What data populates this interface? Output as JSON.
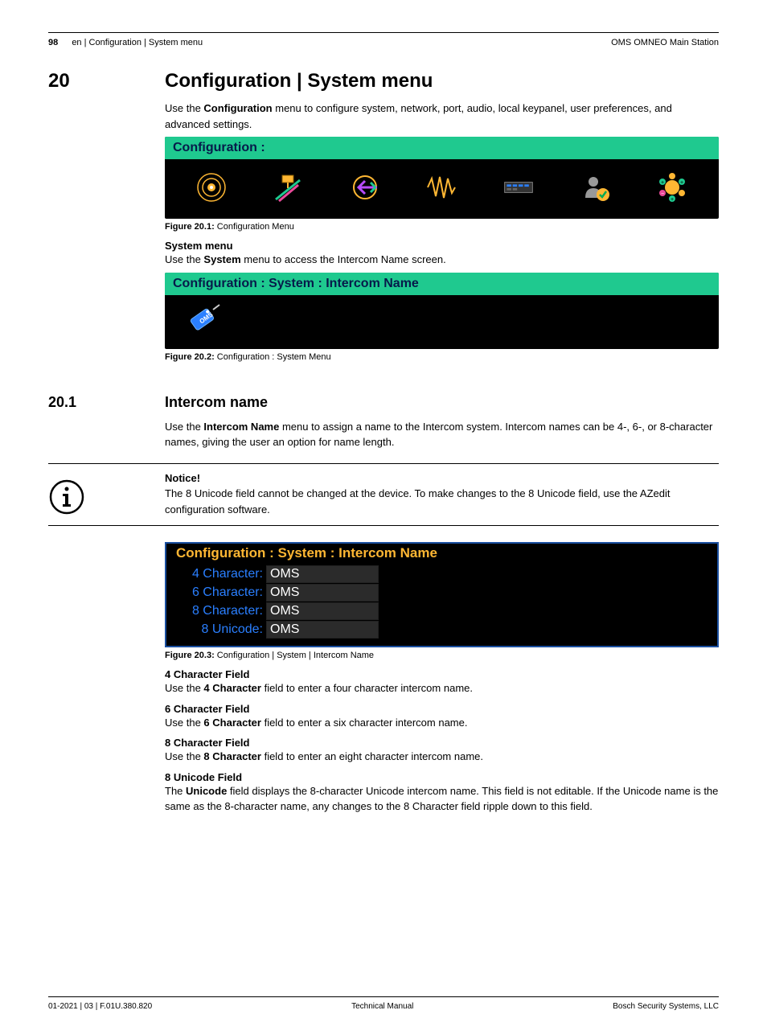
{
  "header": {
    "page_number": "98",
    "breadcrumb": "en | Configuration | System menu",
    "product": "OMS OMNEO Main Station"
  },
  "section": {
    "number": "20",
    "title": "Configuration | System menu",
    "intro_pre": "Use the ",
    "intro_bold": "Configuration",
    "intro_post": " menu to configure system, network, port, audio, local keypanel, user preferences, and advanced settings."
  },
  "fig1": {
    "header": "Configuration :",
    "caption_label": "Figure 20.1:",
    "caption_text": " Configuration Menu"
  },
  "sysmenu": {
    "heading": "System menu",
    "pre": "Use the ",
    "bold": "System",
    "post": " menu to access the Intercom Name screen."
  },
  "fig2": {
    "header": "Configuration : System : Intercom Name",
    "caption_label": "Figure 20.2:",
    "caption_text": " Configuration : System Menu"
  },
  "sub": {
    "number": "20.1",
    "title": "Intercom name",
    "p_pre": "Use the ",
    "p_bold": "Intercom Name",
    "p_post": " menu to assign a name to the Intercom system. Intercom names can be 4-, 6-, or 8-character names, giving the user an option for name length."
  },
  "notice": {
    "heading": "Notice!",
    "body": "The 8 Unicode field cannot be changed at the device. To make changes to the 8 Unicode field, use the AZedit configuration software."
  },
  "fig3": {
    "header": "Configuration : System : Intercom Name",
    "rows": [
      {
        "label": "4 Character:",
        "value": "OMS"
      },
      {
        "label": "6 Character:",
        "value": "OMS"
      },
      {
        "label": "8 Character:",
        "value": "OMS"
      },
      {
        "label": "8 Unicode:",
        "value": "OMS"
      }
    ],
    "caption_label": "Figure 20.3:",
    "caption_text": " Configuration | System | Intercom Name"
  },
  "fields": {
    "f4": {
      "h": "4 Character Field",
      "pre": "Use the ",
      "b": "4 Character",
      "post": " field to enter a four character intercom name."
    },
    "f6": {
      "h": "6 Character Field",
      "pre": "Use the ",
      "b": "6 Character",
      "post": " field to enter a six character intercom name."
    },
    "f8": {
      "h": "8 Character Field",
      "pre": "Use the ",
      "b": "8 Character",
      "post": " field to enter an eight character intercom name."
    },
    "fu": {
      "h": "8 Unicode Field",
      "pre": "The ",
      "b": "Unicode",
      "post": " field displays the 8-character Unicode intercom name. This field is not editable. If the Unicode name is the same as the 8-character name, any changes to the 8 Character field ripple down to this field."
    }
  },
  "footer": {
    "left": "01-2021 | 03 | F.01U.380.820",
    "center": "Technical Manual",
    "right": "Bosch Security Systems, LLC"
  }
}
